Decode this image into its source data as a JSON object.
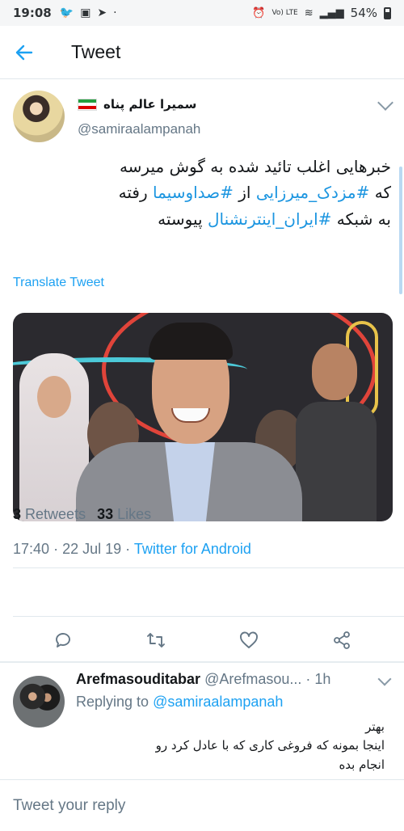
{
  "status_bar": {
    "time": "19:08",
    "network_label": "Vo) LTE",
    "battery": "54%"
  },
  "header": {
    "title": "Tweet"
  },
  "tweet": {
    "author_name": "سمیرا عالم پناه",
    "author_handle": "@samiraalampanah",
    "text_lines": [
      [
        {
          "t": "خبرهایی اغلب تائید شده به گوش میرسه",
          "h": false
        }
      ],
      [
        {
          "t": "که ",
          "h": false
        },
        {
          "t": "#مزدک_میرزایی",
          "h": true
        },
        {
          "t": " از ",
          "h": false
        },
        {
          "t": "#صداوسیما",
          "h": true
        },
        {
          "t": " رفته",
          "h": false
        }
      ],
      [
        {
          "t": "به شبکه ",
          "h": false
        },
        {
          "t": "#ایران_اینترنشنال",
          "h": true
        },
        {
          "t": " پیوسته",
          "h": false
        }
      ]
    ],
    "translate_label": "Translate Tweet",
    "time": "17:40",
    "date": "22 Jul 19",
    "source": "Twitter for Android",
    "retweets_count": "3",
    "retweets_label": "Retweets",
    "likes_count": "33",
    "likes_label": "Likes"
  },
  "actions": [
    {
      "icon": "reply-icon"
    },
    {
      "icon": "retweet-icon"
    },
    {
      "icon": "heart-icon"
    },
    {
      "icon": "share-icon"
    }
  ],
  "reply": {
    "author_name": "Arefmasouditabar",
    "author_handle": "@Arefmasou...",
    "age": "· 1h",
    "replying_prefix": "Replying to",
    "replying_to": "@samiraalampanah",
    "text_lines": [
      "بهتر",
      "اینجا بمونه که فروغی کاری که با عادل کرد رو",
      "انجام بده"
    ]
  },
  "compose": {
    "placeholder": "Tweet your reply"
  },
  "colors": {
    "accent": "#1da1f2",
    "muted": "#657786",
    "divider": "#e1e8ed"
  }
}
